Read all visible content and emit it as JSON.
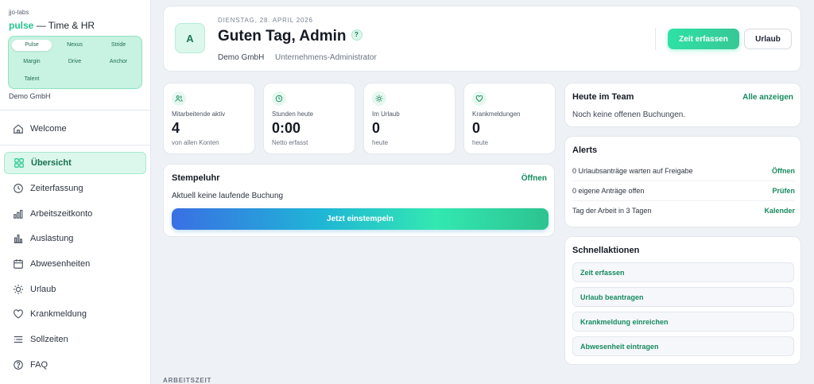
{
  "sidebar": {
    "org_small": "jjo-labs",
    "brand_pulse": "pulse",
    "brand_rest": " — Time & HR",
    "modules": [
      "Pulse",
      "Nexus",
      "Stride",
      "Margin",
      "Drive",
      "Anchor",
      "Talent"
    ],
    "active_module": "Pulse",
    "org_name": "Demo GmbH",
    "welcome": {
      "label": "Welcome",
      "icon": "home-icon"
    },
    "items": [
      {
        "label": "Übersicht",
        "icon": "grid-icon",
        "active": true
      },
      {
        "label": "Zeiterfassung",
        "icon": "clock-icon"
      },
      {
        "label": "Arbeitszeitkonto",
        "icon": "bar-chart-icon"
      },
      {
        "label": "Auslastung",
        "icon": "columns-chart-icon"
      },
      {
        "label": "Abwesenheiten",
        "icon": "calendar-icon"
      },
      {
        "label": "Urlaub",
        "icon": "sun-icon"
      },
      {
        "label": "Krankmeldung",
        "icon": "heart-icon"
      },
      {
        "label": "Sollzeiten",
        "icon": "sliders-icon"
      },
      {
        "label": "FAQ",
        "icon": "help-circle-icon"
      }
    ]
  },
  "hero": {
    "avatar": "A",
    "date": "DIENSTAG, 28. APRIL 2026",
    "greeting": "Guten Tag, Admin",
    "help": "?",
    "company": "Demo GmbH",
    "role": "Unternehmens-Administrator",
    "primary_button": "Zeit erfassen",
    "secondary_button": "Urlaub"
  },
  "stats": [
    {
      "label": "Mitarbeitende aktiv",
      "value": "4",
      "sub": "von allen Konten",
      "icon": "users-icon"
    },
    {
      "label": "Stunden heute",
      "value": "0:00",
      "sub": "Netto erfasst",
      "icon": "clock-icon"
    },
    {
      "label": "Im Urlaub",
      "value": "0",
      "sub": "heute",
      "icon": "sun-icon"
    },
    {
      "label": "Krankmeldungen",
      "value": "0",
      "sub": "heute",
      "icon": "heart-icon"
    }
  ],
  "clock": {
    "title": "Stempeluhr",
    "link": "Öffnen",
    "text": "Aktuell keine laufende Buchung",
    "button": "Jetzt einstempeln"
  },
  "section_label": "ARBEITSZEIT",
  "team": {
    "title": "Heute im Team",
    "link": "Alle anzeigen",
    "text": "Noch keine offenen Buchungen."
  },
  "alerts": {
    "title": "Alerts",
    "rows": [
      {
        "text": "0 Urlaubsanträge warten auf Freigabe",
        "action": "Öffnen"
      },
      {
        "text": "0 eigene Anträge offen",
        "action": "Prüfen"
      },
      {
        "text": "Tag der Arbeit in 3 Tagen",
        "action": "Kalender"
      }
    ]
  },
  "quick": {
    "title": "Schnellaktionen",
    "actions": [
      "Zeit erfassen",
      "Urlaub beantragen",
      "Krankmeldung einreichen",
      "Abwesenheit eintragen"
    ]
  },
  "colors": {
    "accent": "#22c58f",
    "accent_dark": "#178a5f",
    "background": "#eef1f5"
  }
}
